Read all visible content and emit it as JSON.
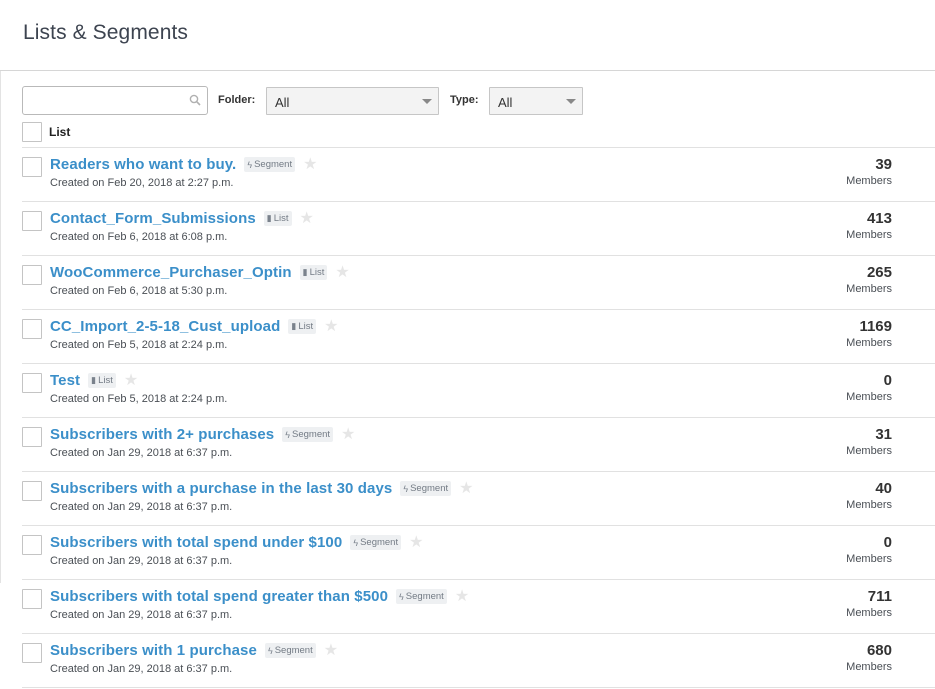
{
  "page": {
    "title": "Lists & Segments"
  },
  "filters": {
    "search_value": "",
    "search_placeholder": "",
    "folder_label": "Folder:",
    "folder_value": "All",
    "type_label": "Type:",
    "type_value": "All"
  },
  "table": {
    "column_label": "List",
    "rows": [
      {
        "name": "Readers who want to buy.",
        "type": "Segment",
        "type_icon": "lightning-icon",
        "created": "Created on Feb 20, 2018 at 2:27 p.m.",
        "count": "39",
        "members_label": "Members"
      },
      {
        "name": "Contact_Form_Submissions",
        "type": "List",
        "type_icon": "document-icon",
        "created": "Created on Feb 6, 2018 at 6:08 p.m.",
        "count": "413",
        "members_label": "Members"
      },
      {
        "name": "WooCommerce_Purchaser_Optin",
        "type": "List",
        "type_icon": "document-icon",
        "created": "Created on Feb 6, 2018 at 5:30 p.m.",
        "count": "265",
        "members_label": "Members"
      },
      {
        "name": "CC_Import_2-5-18_Cust_upload",
        "type": "List",
        "type_icon": "document-icon",
        "created": "Created on Feb 5, 2018 at 2:24 p.m.",
        "count": "1169",
        "members_label": "Members"
      },
      {
        "name": "Test",
        "type": "List",
        "type_icon": "document-icon",
        "created": "Created on Feb 5, 2018 at 2:24 p.m.",
        "count": "0",
        "members_label": "Members"
      },
      {
        "name": "Subscribers with 2+ purchases",
        "type": "Segment",
        "type_icon": "lightning-icon",
        "created": "Created on Jan 29, 2018 at 6:37 p.m.",
        "count": "31",
        "members_label": "Members"
      },
      {
        "name": "Subscribers with a purchase in the last 30 days",
        "type": "Segment",
        "type_icon": "lightning-icon",
        "created": "Created on Jan 29, 2018 at 6:37 p.m.",
        "count": "40",
        "members_label": "Members"
      },
      {
        "name": "Subscribers with total spend under $100",
        "type": "Segment",
        "type_icon": "lightning-icon",
        "created": "Created on Jan 29, 2018 at 6:37 p.m.",
        "count": "0",
        "members_label": "Members"
      },
      {
        "name": "Subscribers with total spend greater than $500",
        "type": "Segment",
        "type_icon": "lightning-icon",
        "created": "Created on Jan 29, 2018 at 6:37 p.m.",
        "count": "711",
        "members_label": "Members"
      },
      {
        "name": "Subscribers with 1 purchase",
        "type": "Segment",
        "type_icon": "lightning-icon",
        "created": "Created on Jan 29, 2018 at 6:37 p.m.",
        "count": "680",
        "members_label": "Members"
      }
    ]
  },
  "colors": {
    "link": "#3b8fc9",
    "border": "#e1e1e1",
    "badge_bg": "#eef0f2"
  }
}
